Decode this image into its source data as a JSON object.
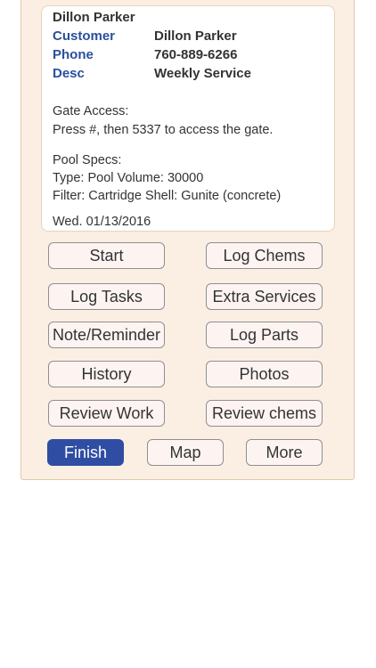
{
  "customer_card": {
    "name_header": "Dillon Parker",
    "fields": [
      {
        "label": "Customer",
        "value": "Dillon Parker"
      },
      {
        "label": "Phone",
        "value": "760-889-6266"
      },
      {
        "label": "Desc",
        "value": "Weekly Service"
      }
    ],
    "gate_access_label": "Gate Access:",
    "gate_access_text": "Press #, then 5337 to access the gate.",
    "pool_specs_label": "Pool Specs:",
    "pool_type": "Type: Pool Volume: 30000",
    "pool_filter": "Filter: Cartridge Shell: Gunite (concrete)",
    "date": "Wed. 01/13/2016"
  },
  "actions": {
    "start": "Start",
    "log_chems": "Log Chems",
    "log_tasks": "Log Tasks",
    "extra_services": "Extra Services",
    "note_reminder": "Note/Reminder",
    "log_parts": "Log Parts",
    "history": "History",
    "photos": "Photos",
    "review_work": "Review Work",
    "review_chems": "Review chems",
    "finish": "Finish",
    "map": "Map",
    "more": "More"
  },
  "colors": {
    "panel_bg": "#fbefe3",
    "label_blue": "#2b4f9c",
    "primary_button": "#2f4da3"
  }
}
